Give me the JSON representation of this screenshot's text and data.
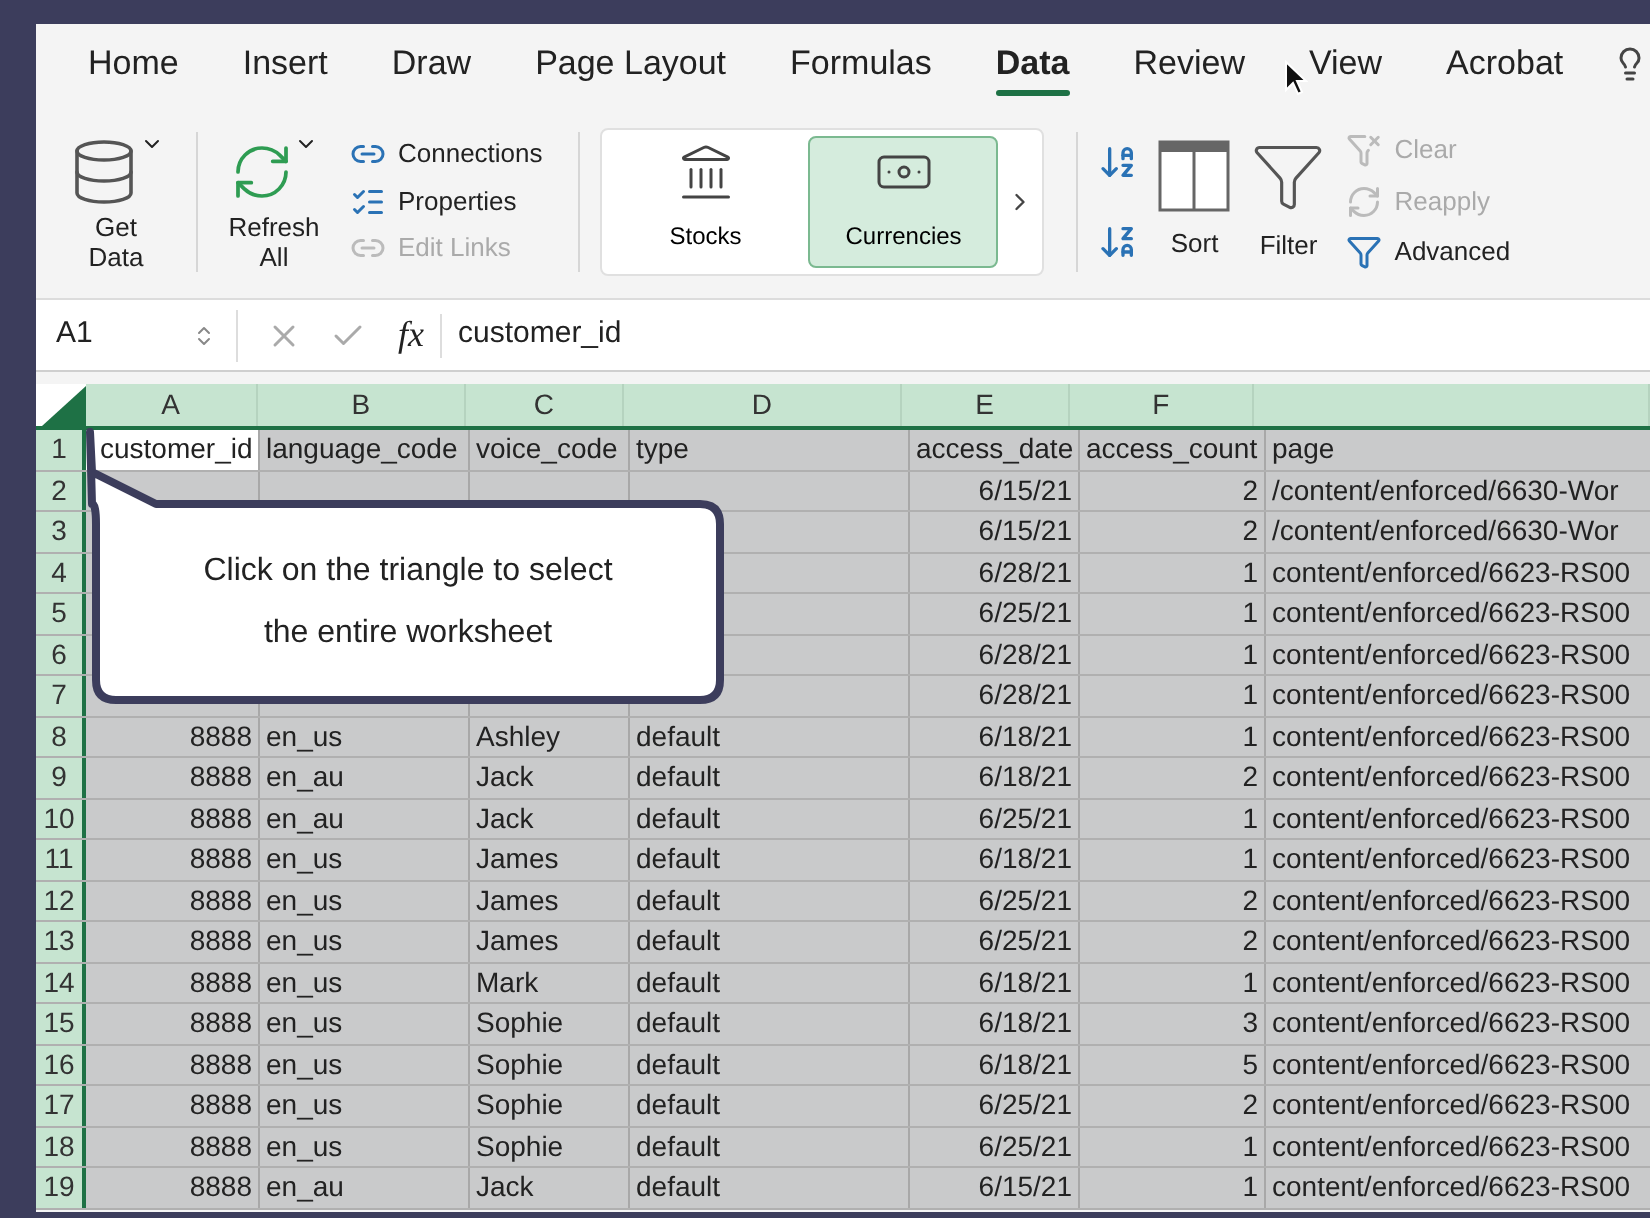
{
  "menu_tabs": [
    {
      "label": "Home",
      "selected": false
    },
    {
      "label": "Insert",
      "selected": false
    },
    {
      "label": "Draw",
      "selected": false
    },
    {
      "label": "Page Layout",
      "selected": false
    },
    {
      "label": "Formulas",
      "selected": false
    },
    {
      "label": "Data",
      "selected": true
    },
    {
      "label": "Review",
      "selected": false
    },
    {
      "label": "View",
      "selected": false
    },
    {
      "label": "Acrobat",
      "selected": false
    }
  ],
  "ribbon": {
    "get_data": "Get Data",
    "refresh_all": "Refresh All",
    "links": [
      {
        "label": "Connections",
        "disabled": false
      },
      {
        "label": "Properties",
        "disabled": false
      },
      {
        "label": "Edit Links",
        "disabled": true
      }
    ],
    "data_types": [
      {
        "label": "Stocks",
        "selected": false
      },
      {
        "label": "Currencies",
        "selected": true
      }
    ],
    "sort": "Sort",
    "filter": "Filter",
    "filter_options": [
      {
        "label": "Clear",
        "disabled": true
      },
      {
        "label": "Reapply",
        "disabled": true
      },
      {
        "label": "Advanced",
        "disabled": false
      }
    ]
  },
  "formula_bar": {
    "cell_ref": "A1",
    "fx": "fx",
    "value": "customer_id"
  },
  "sheet": {
    "all_selected": true,
    "column_headers": [
      "A",
      "B",
      "C",
      "D",
      "E",
      "F"
    ],
    "rows": [
      {
        "number": "1",
        "kind": "header",
        "cells": [
          "customer_id",
          "language_code",
          "voice_code",
          "type",
          "access_date",
          "access_count",
          "page"
        ]
      },
      {
        "number": "2",
        "kind": "data",
        "cells": [
          null,
          null,
          null,
          null,
          "6/15/21",
          "2",
          "/content/enforced/6630-Wor"
        ]
      },
      {
        "number": "3",
        "kind": "data",
        "cells": [
          null,
          null,
          null,
          null,
          "6/15/21",
          "2",
          "/content/enforced/6630-Wor"
        ]
      },
      {
        "number": "4",
        "kind": "data",
        "cells": [
          null,
          null,
          null,
          null,
          "6/28/21",
          "1",
          "content/enforced/6623-RS00"
        ]
      },
      {
        "number": "5",
        "kind": "data",
        "cells": [
          null,
          null,
          null,
          null,
          "6/25/21",
          "1",
          "content/enforced/6623-RS00"
        ]
      },
      {
        "number": "6",
        "kind": "data",
        "cells": [
          null,
          null,
          null,
          null,
          "6/28/21",
          "1",
          "content/enforced/6623-RS00"
        ]
      },
      {
        "number": "7",
        "kind": "data",
        "cells": [
          null,
          null,
          null,
          null,
          "6/28/21",
          "1",
          "content/enforced/6623-RS00"
        ]
      },
      {
        "number": "8",
        "kind": "data",
        "cells": [
          "8888",
          "en_us",
          "Ashley",
          "default",
          "6/18/21",
          "1",
          "content/enforced/6623-RS00"
        ]
      },
      {
        "number": "9",
        "kind": "data",
        "cells": [
          "8888",
          "en_au",
          "Jack",
          "default",
          "6/18/21",
          "2",
          "content/enforced/6623-RS00"
        ]
      },
      {
        "number": "10",
        "kind": "data",
        "cells": [
          "8888",
          "en_au",
          "Jack",
          "default",
          "6/25/21",
          "1",
          "content/enforced/6623-RS00"
        ]
      },
      {
        "number": "11",
        "kind": "data",
        "cells": [
          "8888",
          "en_us",
          "James",
          "default",
          "6/18/21",
          "1",
          "content/enforced/6623-RS00"
        ]
      },
      {
        "number": "12",
        "kind": "data",
        "cells": [
          "8888",
          "en_us",
          "James",
          "default",
          "6/25/21",
          "2",
          "content/enforced/6623-RS00"
        ]
      },
      {
        "number": "13",
        "kind": "data",
        "cells": [
          "8888",
          "en_us",
          "James",
          "default",
          "6/25/21",
          "2",
          "content/enforced/6623-RS00"
        ]
      },
      {
        "number": "14",
        "kind": "data",
        "cells": [
          "8888",
          "en_us",
          "Mark",
          "default",
          "6/18/21",
          "1",
          "content/enforced/6623-RS00"
        ]
      },
      {
        "number": "15",
        "kind": "data",
        "cells": [
          "8888",
          "en_us",
          "Sophie",
          "default",
          "6/18/21",
          "3",
          "content/enforced/6623-RS00"
        ]
      },
      {
        "number": "16",
        "kind": "data",
        "cells": [
          "8888",
          "en_us",
          "Sophie",
          "default",
          "6/18/21",
          "5",
          "content/enforced/6623-RS00"
        ]
      },
      {
        "number": "17",
        "kind": "data",
        "cells": [
          "8888",
          "en_us",
          "Sophie",
          "default",
          "6/25/21",
          "2",
          "content/enforced/6623-RS00"
        ]
      },
      {
        "number": "18",
        "kind": "data",
        "cells": [
          "8888",
          "en_us",
          "Sophie",
          "default",
          "6/25/21",
          "1",
          "content/enforced/6623-RS00"
        ]
      },
      {
        "number": "19",
        "kind": "data",
        "cells": [
          "8888",
          "en_au",
          "Jack",
          "default",
          "6/15/21",
          "1",
          "content/enforced/6623-RS00"
        ]
      }
    ]
  },
  "callout": {
    "text": "Click on the triangle to select the entire worksheet"
  }
}
